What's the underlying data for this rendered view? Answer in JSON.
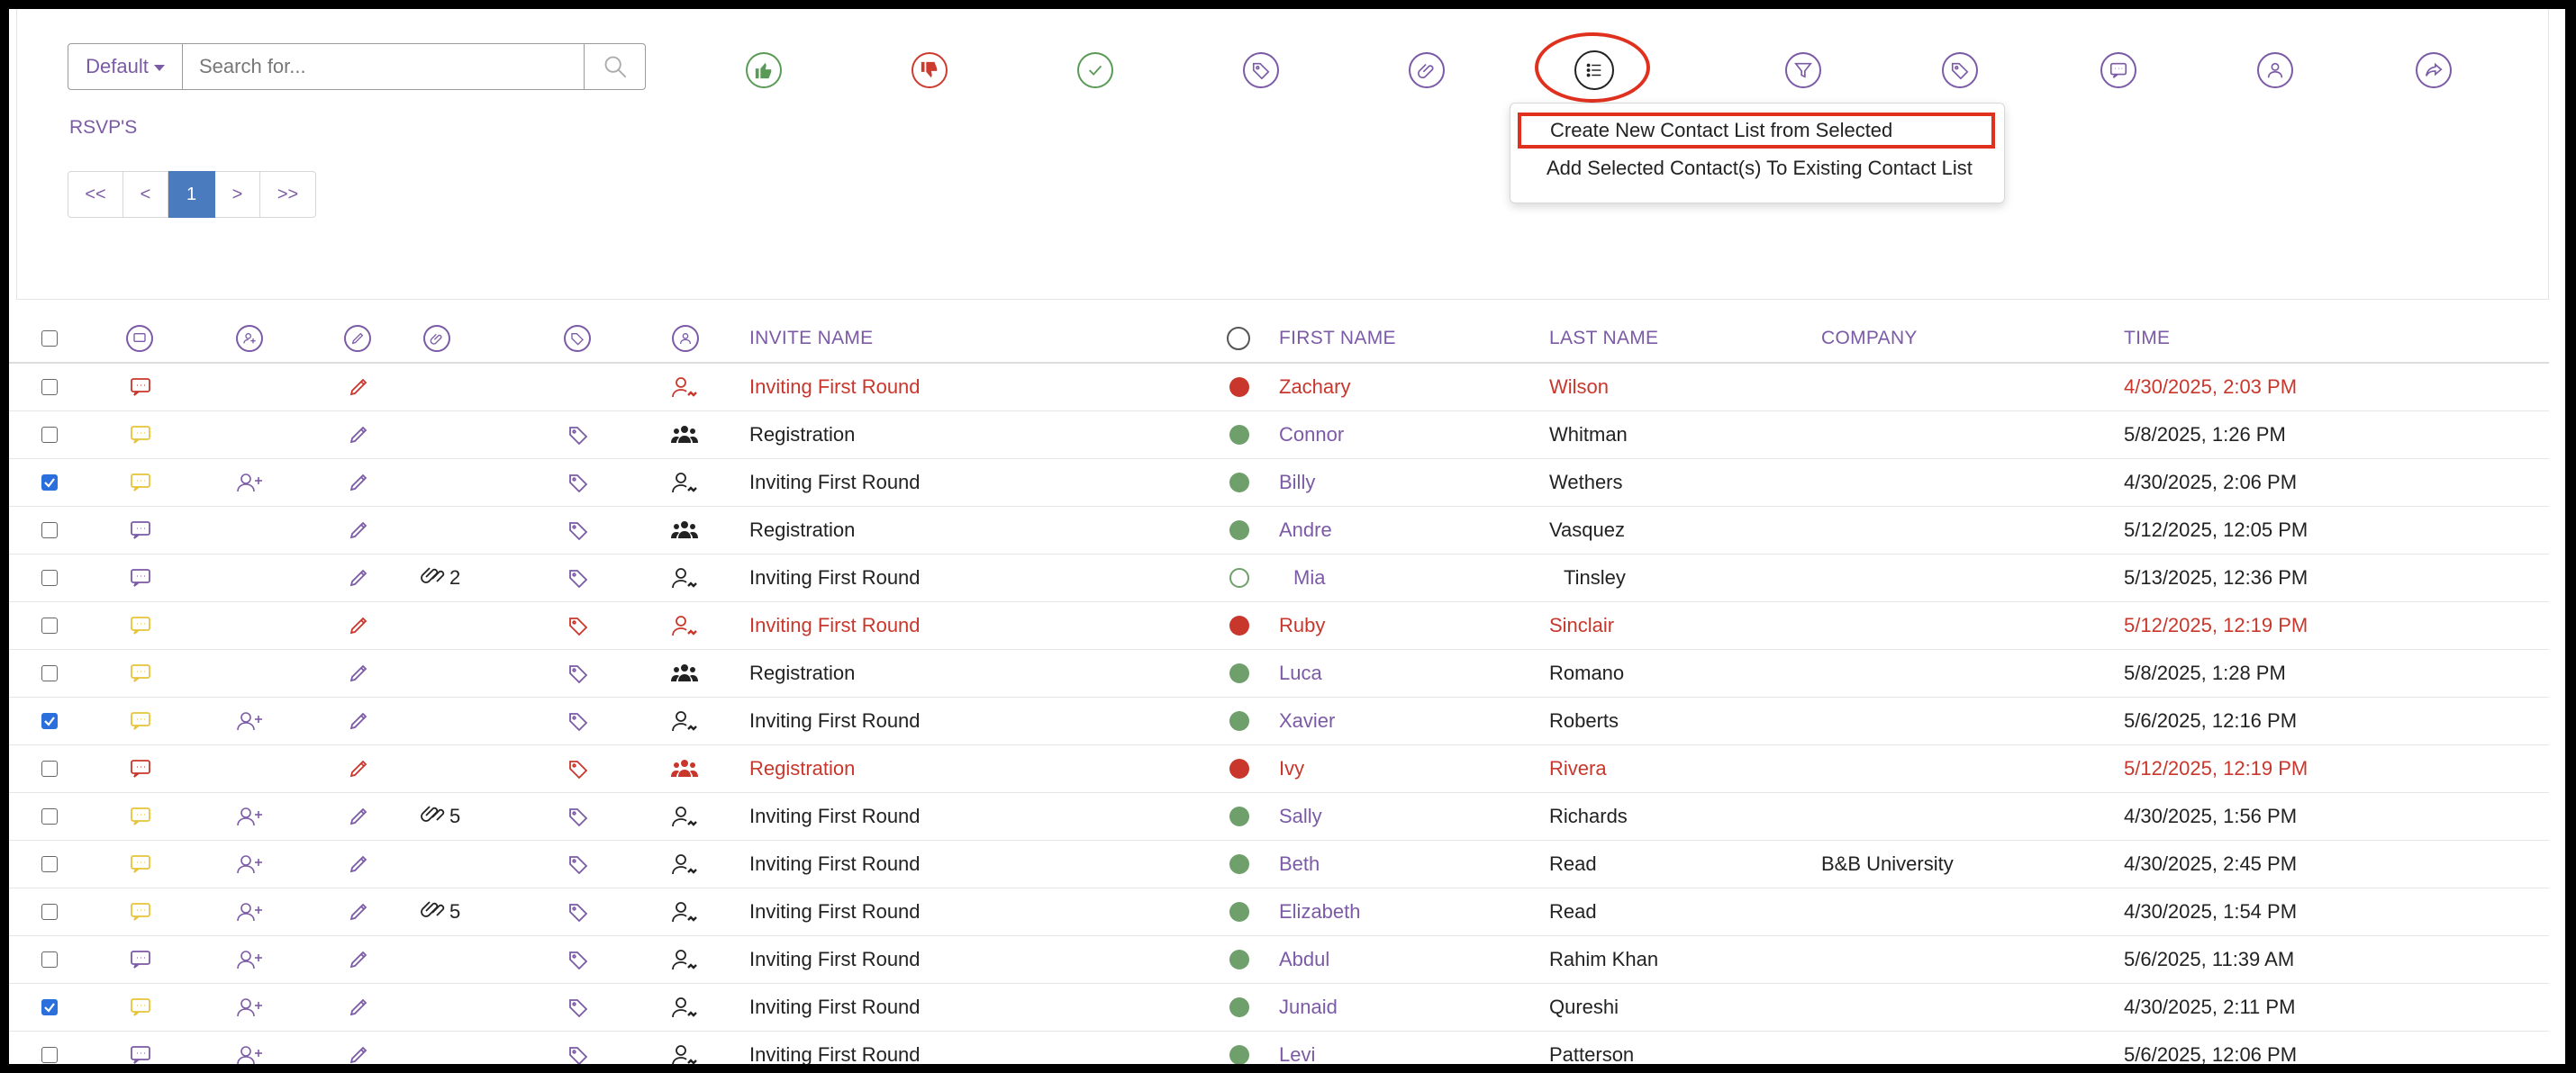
{
  "search": {
    "dropdown_label": "Default",
    "placeholder": "Search for..."
  },
  "filter_label": "RSVP'S",
  "pagination": [
    "<<",
    "<",
    "1",
    ">",
    ">>"
  ],
  "toolbar_icons": [
    "thumbs-up-icon",
    "thumbs-down-icon",
    "check-icon",
    "tag-icon",
    "paperclip-icon",
    "list-icon",
    "filter-icon",
    "tags-icon",
    "message-icon",
    "user-icon",
    "share-icon"
  ],
  "dropdown_menu": {
    "items": [
      "Create New Contact List from Selected",
      "Add Selected Contact(s) To Existing Contact List"
    ]
  },
  "table": {
    "headers": {
      "invite_name": "INVITE NAME",
      "first_name": "FIRST NAME",
      "last_name": "LAST NAME",
      "company": "COMPANY",
      "time": "TIME"
    },
    "rows": [
      {
        "checked": false,
        "msg": "red",
        "add": false,
        "edit": "red",
        "attach": "",
        "tag": "",
        "person": "red-single",
        "invite": "Inviting First Round",
        "status": "red",
        "first": "Zachary",
        "last": "Wilson",
        "company": "",
        "time": "4/30/2025, 2:03 PM",
        "alert": true
      },
      {
        "checked": false,
        "msg": "yellow",
        "add": false,
        "edit": "purple",
        "attach": "",
        "tag": "purple",
        "person": "group",
        "invite": "Registration",
        "status": "green",
        "first": "Connor",
        "last": "Whitman",
        "company": "",
        "time": "5/8/2025, 1:26 PM",
        "alert": false
      },
      {
        "checked": true,
        "msg": "yellow",
        "add": true,
        "edit": "purple",
        "attach": "",
        "tag": "purple",
        "person": "single",
        "invite": "Inviting First Round",
        "status": "green",
        "first": "Billy",
        "last": "Wethers",
        "company": "",
        "time": "4/30/2025, 2:06 PM",
        "alert": false
      },
      {
        "checked": false,
        "msg": "purple",
        "add": false,
        "edit": "purple",
        "attach": "",
        "tag": "purple",
        "person": "group",
        "invite": "Registration",
        "status": "green",
        "first": "Andre",
        "last": "Vasquez",
        "company": "",
        "time": "5/12/2025, 12:05 PM",
        "alert": false
      },
      {
        "checked": false,
        "msg": "purple",
        "add": false,
        "edit": "purple",
        "attach": "2",
        "tag": "purple",
        "person": "single",
        "invite": "Inviting First Round",
        "status": "empty",
        "first": "Mia",
        "last": "Tinsley",
        "company": "",
        "time": "5/13/2025, 12:36 PM",
        "alert": false
      },
      {
        "checked": false,
        "msg": "yellow",
        "add": false,
        "edit": "red",
        "attach": "",
        "tag": "red",
        "person": "red-single",
        "invite": "Inviting First Round",
        "status": "red",
        "first": "Ruby",
        "last": "Sinclair",
        "company": "",
        "time": "5/12/2025, 12:19 PM",
        "alert": true
      },
      {
        "checked": false,
        "msg": "yellow",
        "add": false,
        "edit": "purple",
        "attach": "",
        "tag": "purple",
        "person": "group",
        "invite": "Registration",
        "status": "green",
        "first": "Luca",
        "last": "Romano",
        "company": "",
        "time": "5/8/2025, 1:28 PM",
        "alert": false
      },
      {
        "checked": true,
        "msg": "yellow",
        "add": true,
        "edit": "purple",
        "attach": "",
        "tag": "purple",
        "person": "single",
        "invite": "Inviting First Round",
        "status": "green",
        "first": "Xavier",
        "last": "Roberts",
        "company": "",
        "time": "5/6/2025, 12:16 PM",
        "alert": false
      },
      {
        "checked": false,
        "msg": "red",
        "add": false,
        "edit": "red",
        "attach": "",
        "tag": "red",
        "person": "red-group",
        "invite": "Registration",
        "status": "red",
        "first": "Ivy",
        "last": "Rivera",
        "company": "",
        "time": "5/12/2025, 12:19 PM",
        "alert": true
      },
      {
        "checked": false,
        "msg": "yellow",
        "add": true,
        "edit": "purple",
        "attach": "5",
        "tag": "purple",
        "person": "single",
        "invite": "Inviting First Round",
        "status": "green",
        "first": "Sally",
        "last": "Richards",
        "company": "",
        "time": "4/30/2025, 1:56 PM",
        "alert": false
      },
      {
        "checked": false,
        "msg": "yellow",
        "add": true,
        "edit": "purple",
        "attach": "",
        "tag": "purple",
        "person": "single",
        "invite": "Inviting First Round",
        "status": "green",
        "first": "Beth",
        "last": "Read",
        "company": "B&B University",
        "time": "4/30/2025, 2:45 PM",
        "alert": false
      },
      {
        "checked": false,
        "msg": "yellow",
        "add": true,
        "edit": "purple",
        "attach": "5",
        "tag": "purple",
        "person": "single",
        "invite": "Inviting First Round",
        "status": "green",
        "first": "Elizabeth",
        "last": "Read",
        "company": "",
        "time": "4/30/2025, 1:54 PM",
        "alert": false
      },
      {
        "checked": false,
        "msg": "purple",
        "add": true,
        "edit": "purple",
        "attach": "",
        "tag": "purple",
        "person": "single",
        "invite": "Inviting First Round",
        "status": "green",
        "first": "Abdul",
        "last": "Rahim Khan",
        "company": "",
        "time": "5/6/2025, 11:39 AM",
        "alert": false
      },
      {
        "checked": true,
        "msg": "yellow",
        "add": true,
        "edit": "purple",
        "attach": "",
        "tag": "purple",
        "person": "single",
        "invite": "Inviting First Round",
        "status": "green",
        "first": "Junaid",
        "last": "Qureshi",
        "company": "",
        "time": "4/30/2025, 2:11 PM",
        "alert": false
      },
      {
        "checked": false,
        "msg": "purple",
        "add": true,
        "edit": "purple",
        "attach": "",
        "tag": "purple",
        "person": "single",
        "invite": "Inviting First Round",
        "status": "green",
        "first": "Levi",
        "last": "Patterson",
        "company": "",
        "time": "5/6/2025, 12:06 PM",
        "alert": false
      }
    ]
  },
  "colors": {
    "accent": "#7b5aa6",
    "alert": "#c9372c",
    "green": "#6f9f6b",
    "yellow": "#e8c43a",
    "highlight": "#e0311f",
    "page_active": "#4a7bbf"
  }
}
